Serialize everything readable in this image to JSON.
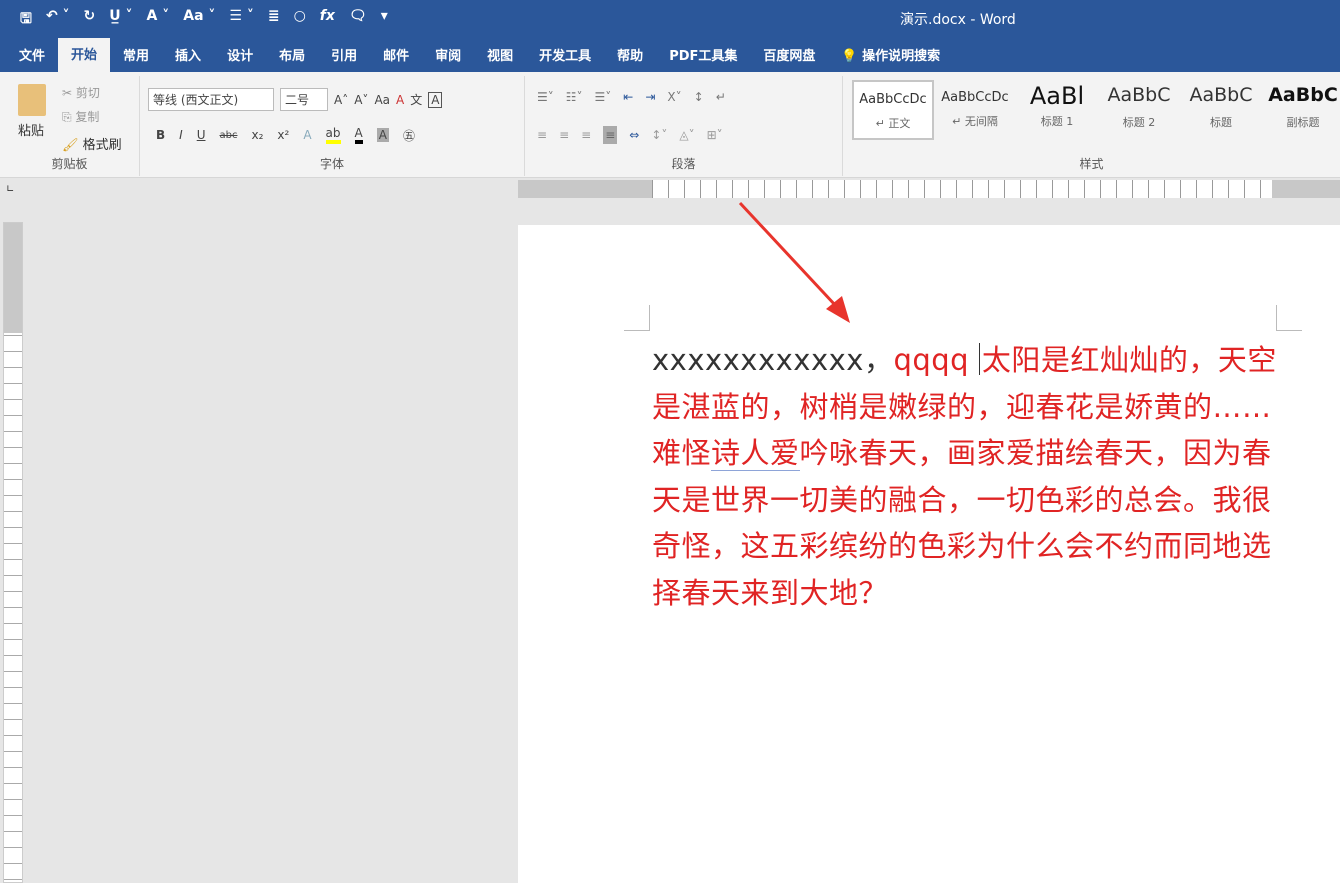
{
  "window": {
    "title": "演示.docx  -  Word"
  },
  "qat": [
    "save-icon",
    "undo-icon",
    "redo-icon",
    "underline-icon",
    "text-effect-icon",
    "change-case-icon",
    "bullets-icon",
    "align-icon",
    "shape-icon",
    "formula-icon",
    "comment-icon",
    "customize-icon"
  ],
  "tabs": [
    "文件",
    "开始",
    "常用",
    "插入",
    "设计",
    "布局",
    "引用",
    "邮件",
    "审阅",
    "视图",
    "开发工具",
    "帮助",
    "PDF工具集",
    "百度网盘"
  ],
  "active_tab": "开始",
  "tell_me": "操作说明搜索",
  "clipboard": {
    "paste": "粘贴",
    "cut": "剪切",
    "copy": "复制",
    "format_painter": "格式刷",
    "label": "剪贴板"
  },
  "font": {
    "name": "等线 (西文正文)",
    "size": "二号",
    "label": "字体",
    "change_case": "Aa",
    "bold": "B",
    "italic": "I",
    "underline": "U",
    "strike": "abc",
    "sub": "x₂",
    "sup": "x²",
    "color": "A"
  },
  "paragraph": {
    "label": "段落"
  },
  "styles": {
    "label": "样式",
    "items": [
      {
        "preview": "AaBbCcDc",
        "name": "↵ 正文"
      },
      {
        "preview": "AaBbCcDc",
        "name": "↵ 无间隔"
      },
      {
        "preview": "AaBl",
        "name": "标题 1"
      },
      {
        "preview": "AaBbC",
        "name": "标题 2"
      },
      {
        "preview": "AaBbC",
        "name": "标题"
      },
      {
        "preview": "AaBbC",
        "name": "副标题"
      }
    ]
  },
  "document": {
    "black_run": "xxxxxxxxxxxx，",
    "red_run": "qqqq ",
    "body_1": "太阳是红灿灿的，天空是湛蓝的，树梢是嫩绿的，迎春花是娇黄的……难怪",
    "squiggle": "诗人爱",
    "body_2": "吟咏春天，画家爱描绘春天，因为春天是世界一切美的融合，一切色彩的总会。我很奇怪，这五彩缤纷的色彩为什么会不约而同地选择春天来到大地？"
  },
  "colors": {
    "brand": "#2b579a",
    "text_red": "#e02424",
    "arrow": "#e8342c"
  }
}
